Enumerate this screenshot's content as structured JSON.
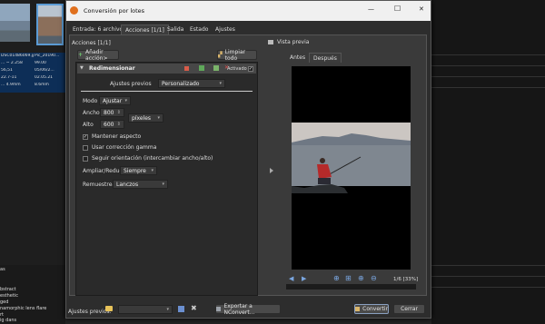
{
  "background": {
    "tile_cells": [
      [
        "DSC01486069.jpg",
        "Pic_20190..."
      ],
      [
        "... ~ 2.258",
        "99.00"
      ],
      [
        "56,51",
        "05/06/2..."
      ],
      [
        "22.7-11",
        "02.05.21"
      ],
      [
        "... 4.9mm",
        "8.6mm"
      ]
    ],
    "list_label": "as",
    "list_items": [
      "bstract",
      "esthetic",
      "ged",
      "namorphic lens flare",
      "rt",
      "ig dans"
    ]
  },
  "window": {
    "title": "Conversión por lotes",
    "controls": {
      "minimize": "—",
      "maximize": "☐",
      "close": "✕"
    }
  },
  "tabs": [
    "Entrada: 6 archivos",
    "Acciones [1/1]",
    "Salida",
    "Estado",
    "Ajustes"
  ],
  "actions_panel": {
    "header": "Acciones [1/1]",
    "add_action": "Añadir acción>",
    "clear_all": "Limpiar todo",
    "action_name": "Redimensionar",
    "enabled_label": "Activado",
    "presets_label": "Ajustes previos",
    "presets_value": "Personalizado",
    "mode_label": "Modo",
    "mode_value": "Ajustar",
    "width_label": "Ancho",
    "width_value": "800",
    "height_label": "Alto",
    "height_value": "600",
    "unit_value": "píxeles",
    "keep_aspect": "Mantener aspecto",
    "gamma": "Usar corrección gamma",
    "follow_orientation": "Seguir orientación (intercambiar ancho/alto)",
    "enlarge_label": "Ampliar/Reducir",
    "enlarge_value": "Siempre",
    "resample_label": "Remuestrear",
    "resample_value": "Lanczos"
  },
  "preview": {
    "header": "Vista previa",
    "tabs": [
      "Antes",
      "Después"
    ],
    "page_info": "1/6 [33%]"
  },
  "bottom": {
    "presets_label": "Ajustes previos:",
    "export_label": "Exportar a NConvert...",
    "convert_label": "Convertir",
    "close_label": "Cerrar"
  },
  "colors": {
    "window_bg": "#2d2d2d",
    "panel_bg": "#3a3a3a",
    "dialog_titlebar": "#f0f0f0",
    "sky": "#c9c5c2",
    "sea": "#7f8790",
    "jacket": "#b52a2a"
  },
  "icons": [
    "app-logo-icon",
    "add-icon",
    "broom-icon",
    "collapse-triangle-icon",
    "move-up-icon",
    "move-down-icon",
    "copy-icon",
    "delete-icon",
    "folder-icon",
    "save-icon",
    "delete-preset-icon",
    "export-icon",
    "convert-icon",
    "prev-icon",
    "next-icon",
    "zoom-in-icon",
    "fit-icon",
    "zoom-out-icon"
  ]
}
